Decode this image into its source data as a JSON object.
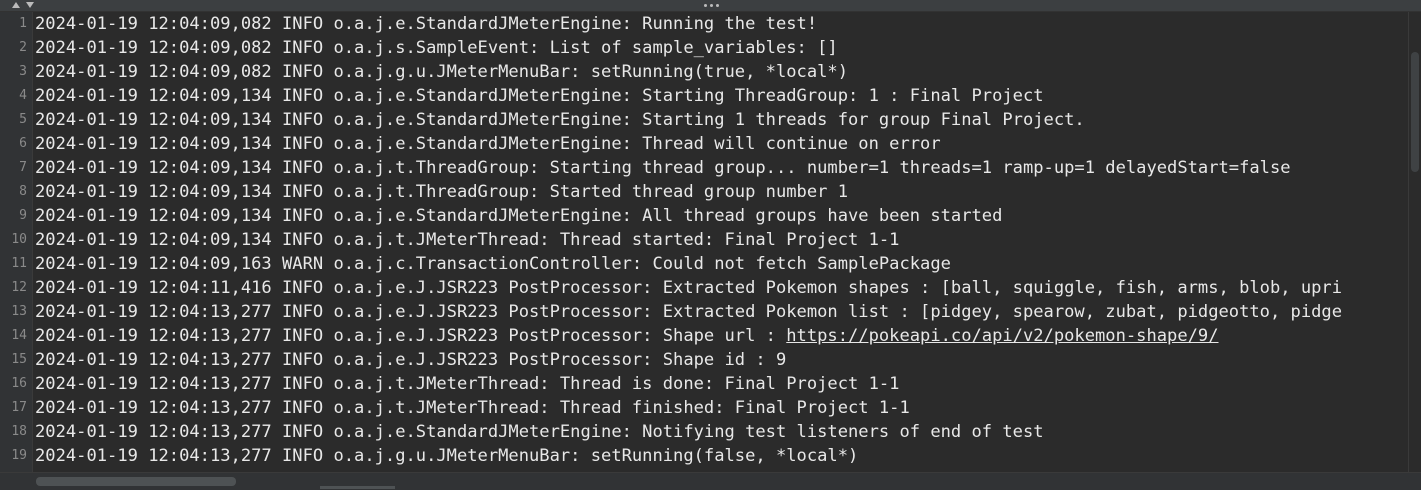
{
  "log": {
    "lines": [
      {
        "n": "1",
        "text": "2024-01-19 12:04:09,082 INFO o.a.j.e.StandardJMeterEngine: Running the test!"
      },
      {
        "n": "2",
        "text": "2024-01-19 12:04:09,082 INFO o.a.j.s.SampleEvent: List of sample_variables: []"
      },
      {
        "n": "3",
        "text": "2024-01-19 12:04:09,082 INFO o.a.j.g.u.JMeterMenuBar: setRunning(true, *local*)"
      },
      {
        "n": "4",
        "text": "2024-01-19 12:04:09,134 INFO o.a.j.e.StandardJMeterEngine: Starting ThreadGroup: 1 : Final Project"
      },
      {
        "n": "5",
        "text": "2024-01-19 12:04:09,134 INFO o.a.j.e.StandardJMeterEngine: Starting 1 threads for group Final Project."
      },
      {
        "n": "6",
        "text": "2024-01-19 12:04:09,134 INFO o.a.j.e.StandardJMeterEngine: Thread will continue on error"
      },
      {
        "n": "7",
        "text": "2024-01-19 12:04:09,134 INFO o.a.j.t.ThreadGroup: Starting thread group... number=1 threads=1 ramp-up=1 delayedStart=false"
      },
      {
        "n": "8",
        "text": "2024-01-19 12:04:09,134 INFO o.a.j.t.ThreadGroup: Started thread group number 1"
      },
      {
        "n": "9",
        "text": "2024-01-19 12:04:09,134 INFO o.a.j.e.StandardJMeterEngine: All thread groups have been started"
      },
      {
        "n": "10",
        "text": "2024-01-19 12:04:09,134 INFO o.a.j.t.JMeterThread: Thread started: Final Project 1-1"
      },
      {
        "n": "11",
        "text": "2024-01-19 12:04:09,163 WARN o.a.j.c.TransactionController: Could not fetch SamplePackage"
      },
      {
        "n": "12",
        "text": "2024-01-19 12:04:11,416 INFO o.a.j.e.J.JSR223 PostProcessor: Extracted Pokemon shapes : [ball, squiggle, fish, arms, blob, upri"
      },
      {
        "n": "13",
        "text": "2024-01-19 12:04:13,277 INFO o.a.j.e.J.JSR223 PostProcessor: Extracted Pokemon list : [pidgey, spearow, zubat, pidgeotto, pidge"
      },
      {
        "n": "14",
        "text": "2024-01-19 12:04:13,277 INFO o.a.j.e.J.JSR223 PostProcessor: Shape url : ",
        "link": "https://pokeapi.co/api/v2/pokemon-shape/9/"
      },
      {
        "n": "15",
        "text": "2024-01-19 12:04:13,277 INFO o.a.j.e.J.JSR223 PostProcessor: Shape id : 9"
      },
      {
        "n": "16",
        "text": "2024-01-19 12:04:13,277 INFO o.a.j.t.JMeterThread: Thread is done: Final Project 1-1"
      },
      {
        "n": "17",
        "text": "2024-01-19 12:04:13,277 INFO o.a.j.t.JMeterThread: Thread finished: Final Project 1-1"
      },
      {
        "n": "18",
        "text": "2024-01-19 12:04:13,277 INFO o.a.j.e.StandardJMeterEngine: Notifying test listeners of end of test"
      },
      {
        "n": "19",
        "text": "2024-01-19 12:04:13,277 INFO o.a.j.g.u.JMeterMenuBar: setRunning(false, *local*)"
      }
    ]
  },
  "colors": {
    "background": "#2b2b2b",
    "gutter": "#313335",
    "text": "#e8e8e8",
    "line_number": "#8a8a8a"
  },
  "icons": {
    "collapse": "triangle-up-icon",
    "expand": "triangle-down-icon",
    "splitter": "drag-handle-icon"
  }
}
